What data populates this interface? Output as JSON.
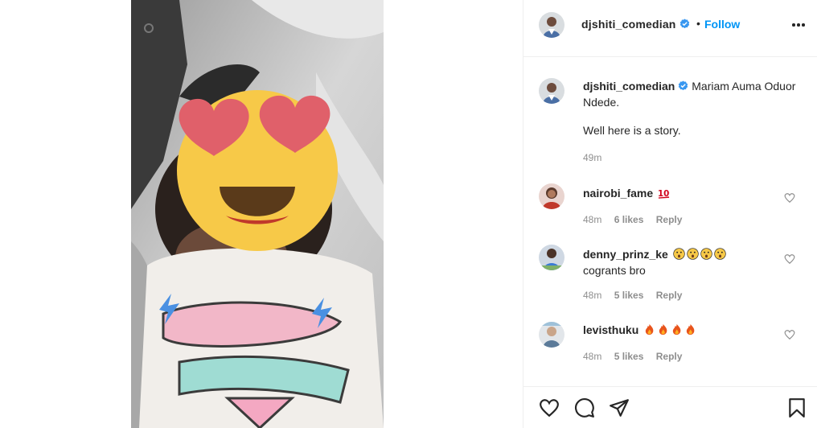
{
  "post": {
    "author": "djshiti_comedian",
    "follow_label": "Follow",
    "separator": "•",
    "caption": "Mariam Auma Oduor Ndede.",
    "caption_line2": "Well here is a story.",
    "caption_time": "49m"
  },
  "comments": [
    {
      "user": "nairobi_fame",
      "text": "",
      "emojis": [
        "hundred-points-emoji"
      ],
      "time": "48m",
      "likes": "6 likes",
      "reply": "Reply"
    },
    {
      "user": "denny_prinz_ke",
      "text": "cogrants bro",
      "emojis": [
        "astonished-face-emoji",
        "astonished-face-emoji",
        "astonished-face-emoji",
        "astonished-face-emoji"
      ],
      "time": "48m",
      "likes": "5 likes",
      "reply": "Reply"
    },
    {
      "user": "levisthuku",
      "text": "",
      "emojis": [
        "fire-emoji",
        "fire-emoji",
        "fire-emoji",
        "fire-emoji"
      ],
      "time": "48m",
      "likes": "5 likes",
      "reply": "Reply"
    }
  ],
  "icons": {
    "verified": "verified-badge-icon",
    "more": "more-options-icon",
    "like": "heart-icon",
    "comment": "comment-bubble-icon",
    "share": "paper-plane-icon",
    "save": "bookmark-icon"
  },
  "colors": {
    "link": "#0095f6",
    "verified": "#3897f0",
    "muted": "#8e8e8e",
    "text": "#262626",
    "border": "#efefef"
  }
}
